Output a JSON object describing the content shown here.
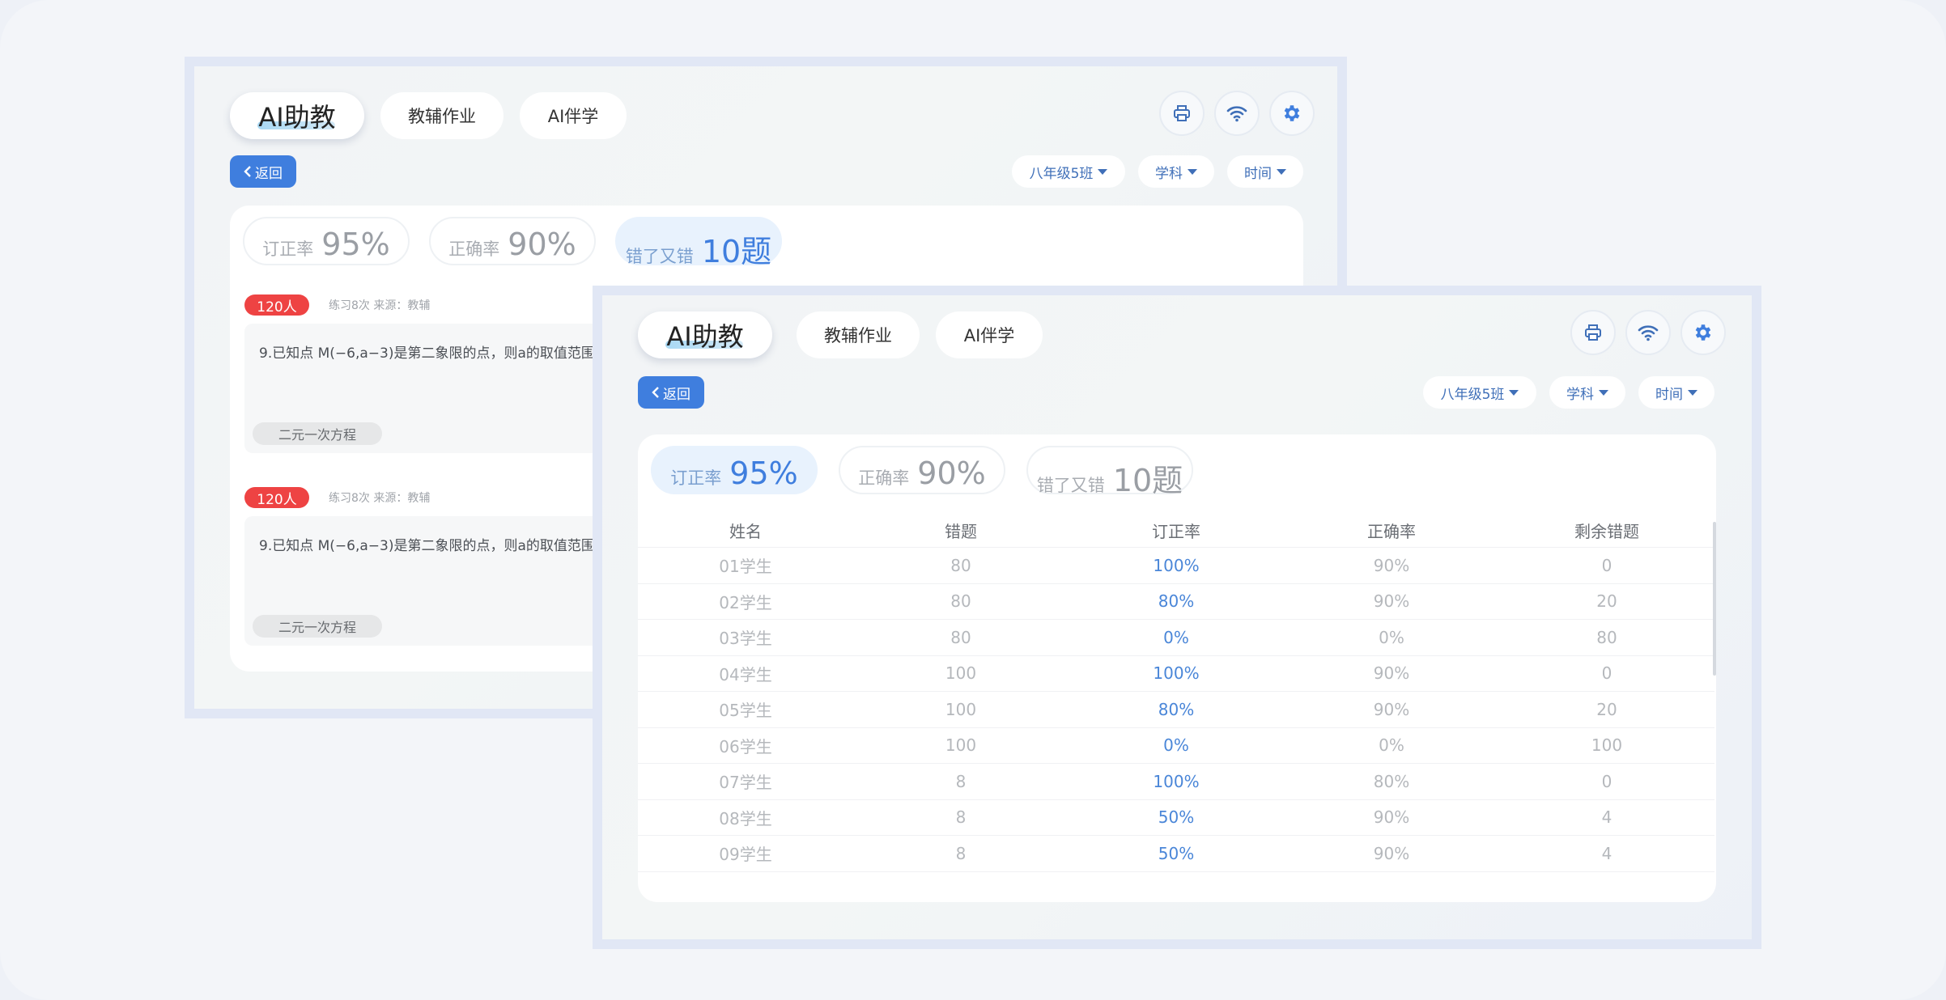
{
  "nav": {
    "tabs": [
      {
        "label": "AI助教",
        "active": true
      },
      {
        "label": "教辅作业",
        "active": false
      },
      {
        "label": "AI伴学",
        "active": false
      }
    ],
    "icons": [
      "printer-icon",
      "wifi-icon",
      "gear-icon"
    ]
  },
  "toolbar": {
    "back_label": "返回",
    "filters": [
      "八年级5班",
      "学科",
      "时间"
    ]
  },
  "stats": [
    {
      "label": "订正率",
      "value": "95%"
    },
    {
      "label": "正确率",
      "value": "90%"
    },
    {
      "label": "错了又错",
      "value": "10题"
    }
  ],
  "back_window": {
    "active_stat": 2,
    "questions": [
      {
        "badge": "120人",
        "meta": "练习8次  来源：教辅",
        "text": "9.已知点 M(−6,a−3)是第二象限的点，则a的取值范围",
        "tag": "二元一次方程"
      },
      {
        "badge": "120人",
        "meta": "练习8次  来源：教辅",
        "text": "9.已知点 M(−6,a−3)是第二象限的点，则a的取值范围",
        "tag": "二元一次方程"
      }
    ]
  },
  "front_window": {
    "active_stat": 0,
    "table": {
      "headers": [
        "姓名",
        "错题",
        "订正率",
        "正确率",
        "剩余错题"
      ],
      "rows": [
        [
          "01学生",
          "80",
          "100%",
          "90%",
          "0"
        ],
        [
          "02学生",
          "80",
          "80%",
          "90%",
          "20"
        ],
        [
          "03学生",
          "80",
          "0%",
          "0%",
          "80"
        ],
        [
          "04学生",
          "100",
          "100%",
          "90%",
          "0"
        ],
        [
          "05学生",
          "100",
          "80%",
          "90%",
          "20"
        ],
        [
          "06学生",
          "100",
          "0%",
          "0%",
          "100"
        ],
        [
          "07学生",
          "8",
          "100%",
          "80%",
          "0"
        ],
        [
          "08学生",
          "8",
          "50%",
          "90%",
          "4"
        ],
        [
          "09学生",
          "8",
          "50%",
          "90%",
          "4"
        ]
      ]
    }
  },
  "colors": {
    "accent": "#3f7ede",
    "badge": "#ee4343",
    "frame": "#e1e7f5"
  }
}
